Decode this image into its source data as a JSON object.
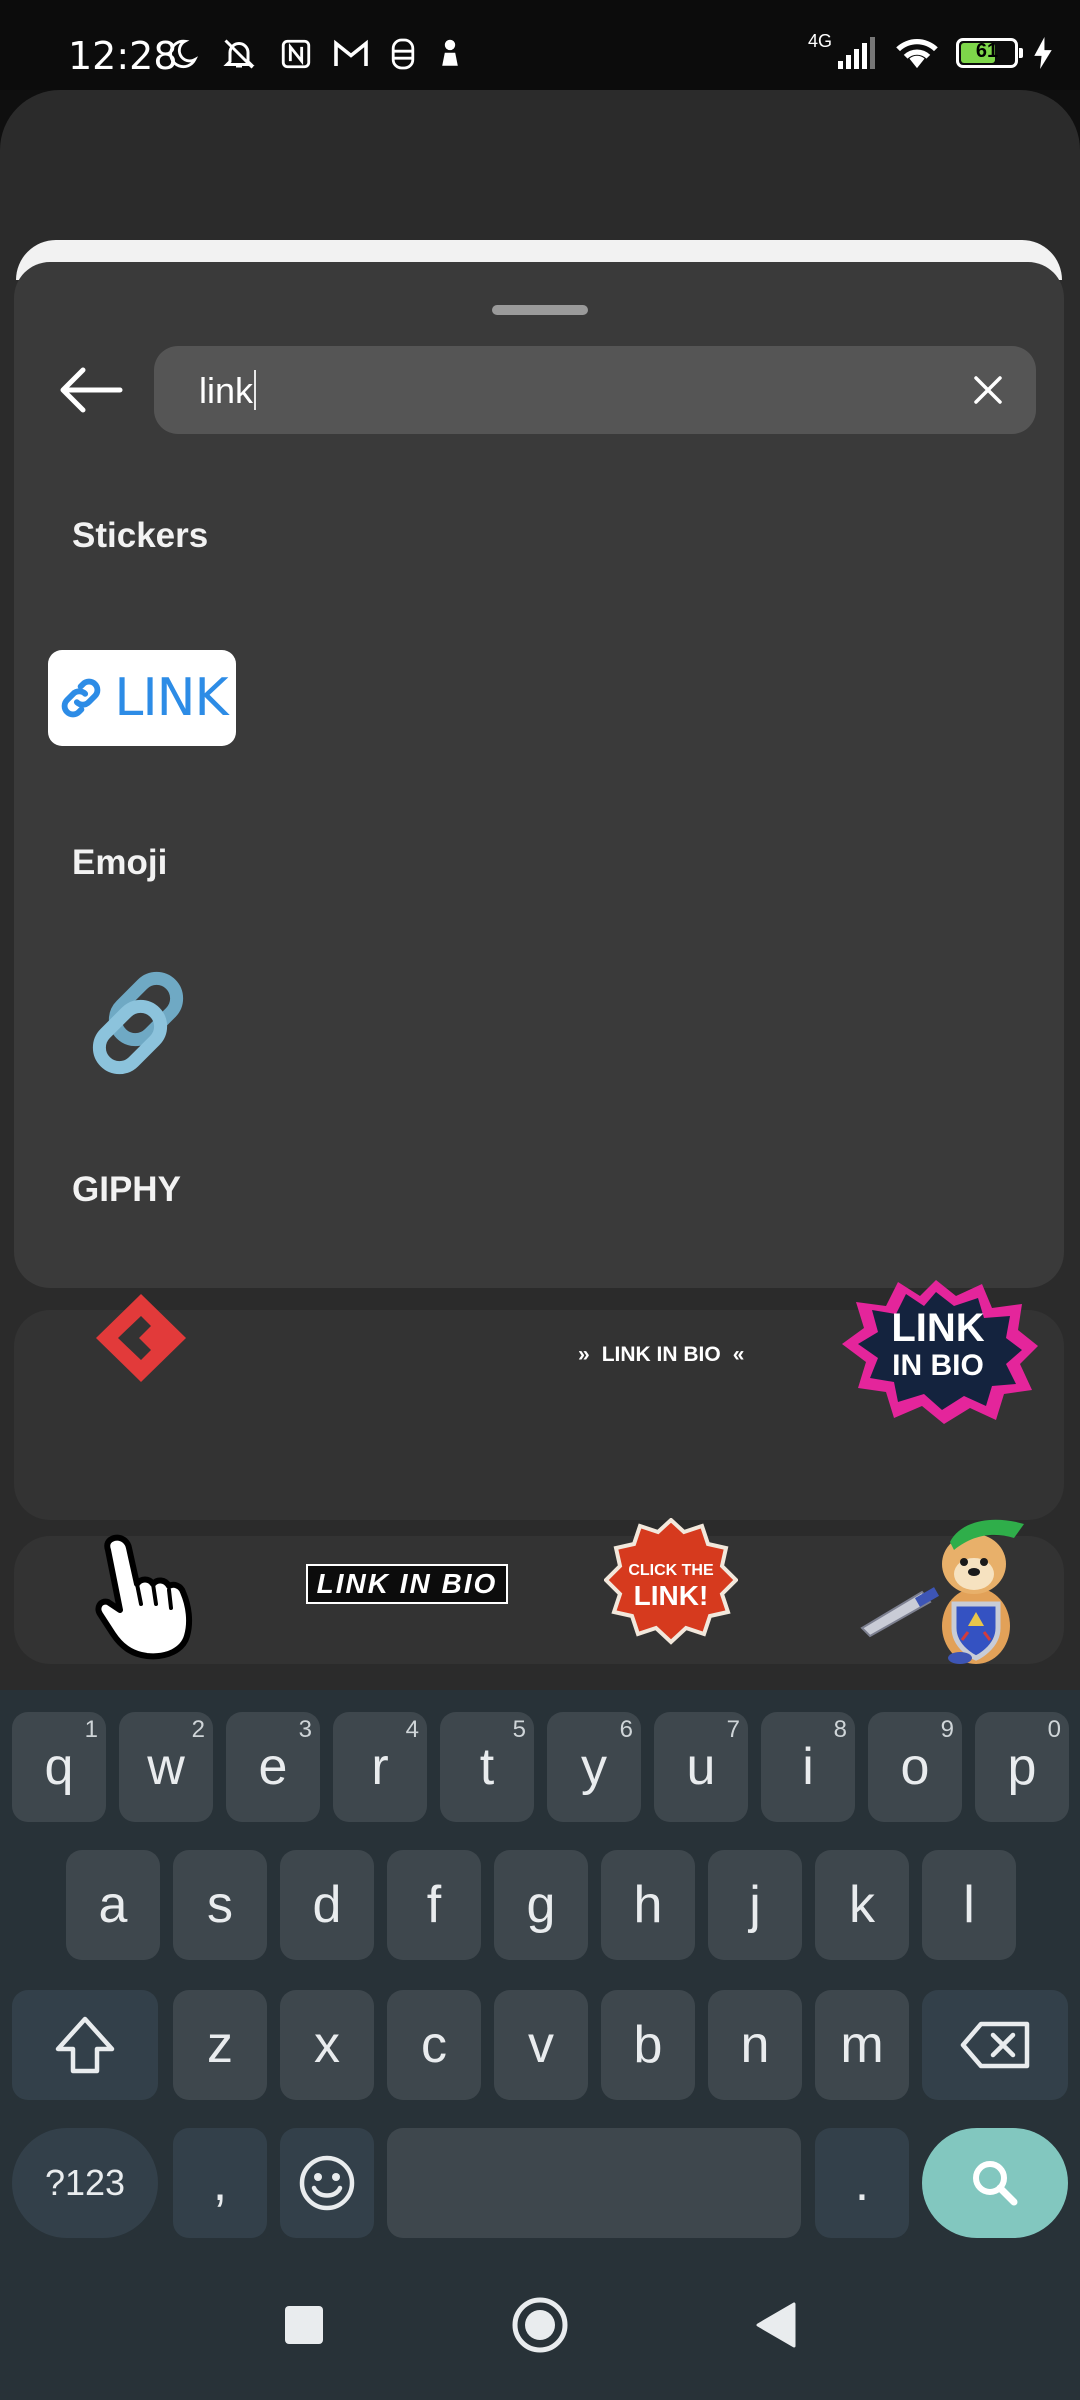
{
  "status_bar": {
    "time": "12:28",
    "network": "4G",
    "battery_level": "61",
    "icons_left": [
      "moon-icon",
      "notifications-off-icon",
      "nfc-icon",
      "gmail-icon",
      "app-icon",
      "chess-pawn-icon"
    ],
    "icons_right": [
      "signal-icon",
      "wifi-icon",
      "battery-icon",
      "charging-icon"
    ]
  },
  "search": {
    "value": "link"
  },
  "sections": {
    "stickers_title": "Stickers",
    "emoji_title": "Emoji",
    "giphy_title": "GIPHY"
  },
  "stickers": {
    "link_label": "LINK"
  },
  "giphy": {
    "link_in_bio_small": "LINK IN BIO",
    "link_in_bio_burst_line1": "LINK",
    "link_in_bio_burst_line2": "IN BIO",
    "link_in_bio_black": "LINK IN BIO",
    "click_link_line1": "CLICK THE",
    "click_link_line2": "LINK!"
  },
  "keyboard": {
    "row1": [
      {
        "k": "q",
        "n": "1"
      },
      {
        "k": "w",
        "n": "2"
      },
      {
        "k": "e",
        "n": "3"
      },
      {
        "k": "r",
        "n": "4"
      },
      {
        "k": "t",
        "n": "5"
      },
      {
        "k": "y",
        "n": "6"
      },
      {
        "k": "u",
        "n": "7"
      },
      {
        "k": "i",
        "n": "8"
      },
      {
        "k": "o",
        "n": "9"
      },
      {
        "k": "p",
        "n": "0"
      }
    ],
    "row2": [
      "a",
      "s",
      "d",
      "f",
      "g",
      "h",
      "j",
      "k",
      "l"
    ],
    "row3": [
      "z",
      "x",
      "c",
      "v",
      "b",
      "n",
      "m"
    ],
    "sym_label": "?123",
    "comma": ",",
    "period": "."
  },
  "colors": {
    "sheet_bg": "#3a3a3a",
    "keyboard_bg": "#283238",
    "key_bg": "#3e474d",
    "search_key": "#82c7bf",
    "link_blue": "#2d8ce6"
  }
}
